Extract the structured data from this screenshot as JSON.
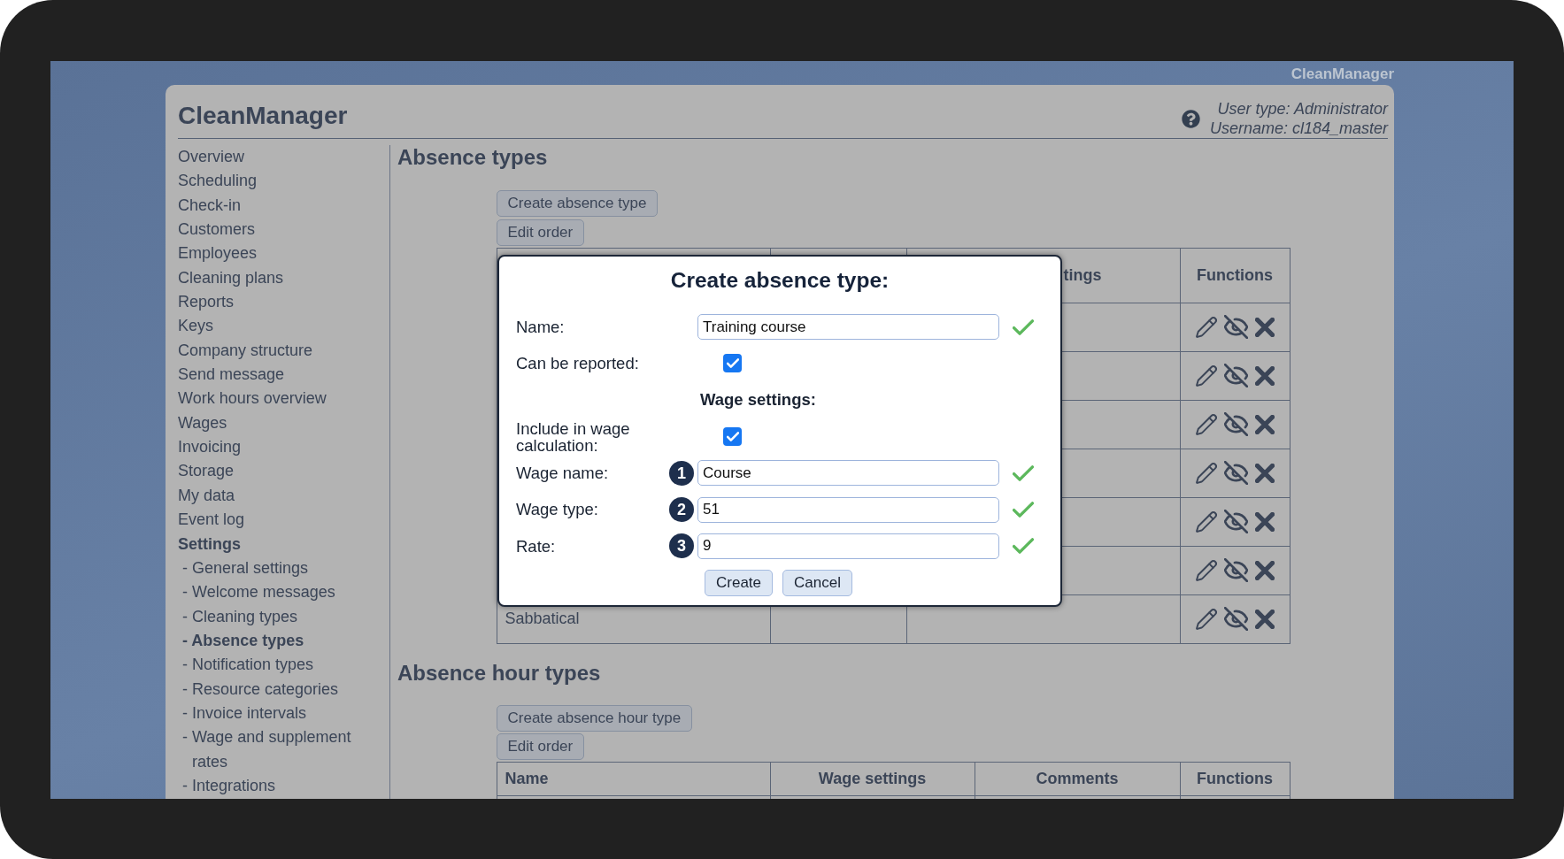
{
  "top_bar": {
    "brand": "CleanManager"
  },
  "header": {
    "title": "CleanManager",
    "user_type": "User type: Administrator",
    "username": "Username: cl184_master"
  },
  "sidebar": {
    "items": [
      {
        "label": "Overview",
        "selected": false
      },
      {
        "label": "Scheduling",
        "selected": false
      },
      {
        "label": "Check-in",
        "selected": false
      },
      {
        "label": "Customers",
        "selected": false
      },
      {
        "label": "Employees",
        "selected": false
      },
      {
        "label": "Cleaning plans",
        "selected": false
      },
      {
        "label": "Reports",
        "selected": false
      },
      {
        "label": "Keys",
        "selected": false
      },
      {
        "label": "Company structure",
        "selected": false
      },
      {
        "label": "Send message",
        "selected": false
      },
      {
        "label": "Work hours overview",
        "selected": false
      },
      {
        "label": "Wages",
        "selected": false
      },
      {
        "label": "Invoicing",
        "selected": false
      },
      {
        "label": "Storage",
        "selected": false
      },
      {
        "label": "My data",
        "selected": false
      },
      {
        "label": "Event log",
        "selected": false
      },
      {
        "label": "Settings",
        "selected": true,
        "children": [
          {
            "label": "- General settings",
            "selected": false
          },
          {
            "label": "- Welcome messages",
            "selected": false
          },
          {
            "label": "- Cleaning types",
            "selected": false
          },
          {
            "label": "- Absence types",
            "selected": true
          },
          {
            "label": "- Notification types",
            "selected": false
          },
          {
            "label": "- Resource categories",
            "selected": false
          },
          {
            "label": "- Invoice intervals",
            "selected": false
          },
          {
            "label": "- Wage and supplement rates",
            "selected": false
          },
          {
            "label": "- Integrations",
            "selected": false
          }
        ]
      }
    ]
  },
  "absence_types": {
    "heading": "Absence types",
    "buttons": [
      "Create absence type",
      "Edit order"
    ],
    "table": {
      "header": {
        "column_3": "tings",
        "functions": "Functions"
      },
      "rows": [
        {},
        {},
        {},
        {},
        {},
        {},
        {
          "name": "Sabbatical"
        }
      ]
    }
  },
  "absence_hour_types": {
    "heading": "Absence hour types",
    "buttons": [
      "Create absence hour type",
      "Edit order"
    ],
    "table": {
      "columns": [
        "Name",
        "Wage settings",
        "Comments",
        "Functions"
      ]
    }
  },
  "dialog": {
    "title": "Create absence type:",
    "fields": [
      {
        "kind": "text",
        "label": "Name:",
        "value": "Training course",
        "valid": true
      },
      {
        "kind": "checkbox",
        "label": "Can be reported:",
        "checked": true
      },
      {
        "kind": "heading",
        "label": "Wage settings:"
      },
      {
        "kind": "checkbox",
        "label": "Include in wage calculation:",
        "checked": true
      },
      {
        "kind": "text",
        "label": "Wage name:",
        "badge": "1",
        "value": "Course",
        "valid": true
      },
      {
        "kind": "text",
        "label": "Wage type:",
        "badge": "2",
        "value": "51",
        "valid": true
      },
      {
        "kind": "text",
        "label": "Rate:",
        "badge": "3",
        "value": "9",
        "valid": true
      }
    ],
    "buttons": [
      "Create",
      "Cancel"
    ]
  }
}
